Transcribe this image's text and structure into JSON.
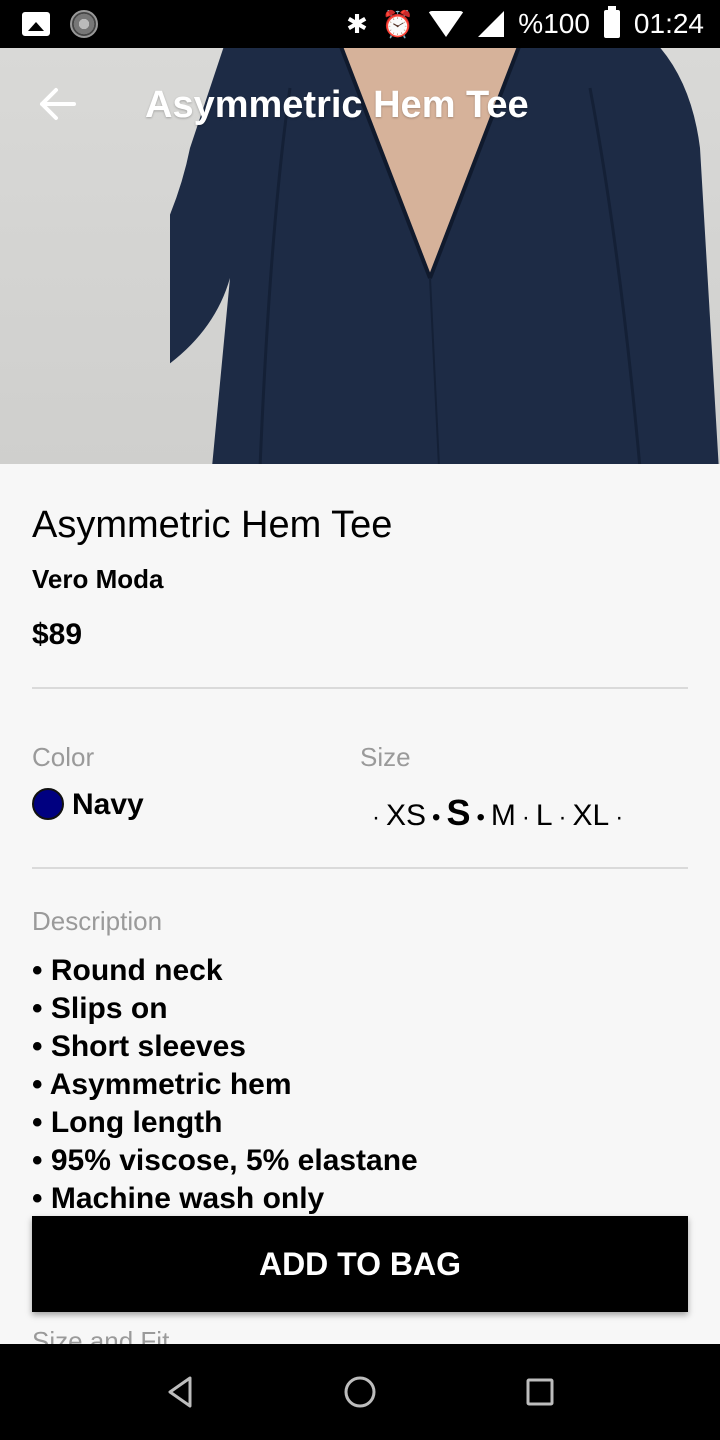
{
  "status_bar": {
    "battery": "%100",
    "time": "01:24"
  },
  "header": {
    "title": "Asymmetric Hem Tee"
  },
  "product": {
    "name": "Asymmetric Hem Tee",
    "brand": "Vero Moda",
    "price": "$89",
    "color_label": "Color",
    "color_name": "Navy",
    "color_hex": "#000080",
    "size_label": "Size",
    "sizes": [
      "XS",
      "S",
      "M",
      "L",
      "XL"
    ],
    "selected_size": "S",
    "description_label": "Description",
    "description": [
      "Round neck",
      "Slips on",
      "Short sleeves",
      "Asymmetric hem",
      "Long length",
      "95% viscose, 5% elastane",
      "Machine wash only"
    ],
    "size_fit_label": "Size and Fit"
  },
  "actions": {
    "add_to_bag": "ADD TO BAG"
  },
  "icons": {
    "status": [
      "image-icon",
      "loader-icon",
      "bluetooth-icon",
      "alarm-icon",
      "wifi-icon",
      "signal-icon",
      "battery-icon"
    ],
    "header": [
      "back-arrow-icon"
    ],
    "nav": [
      "back-triangle-icon",
      "home-circle-icon",
      "recents-square-icon"
    ]
  }
}
